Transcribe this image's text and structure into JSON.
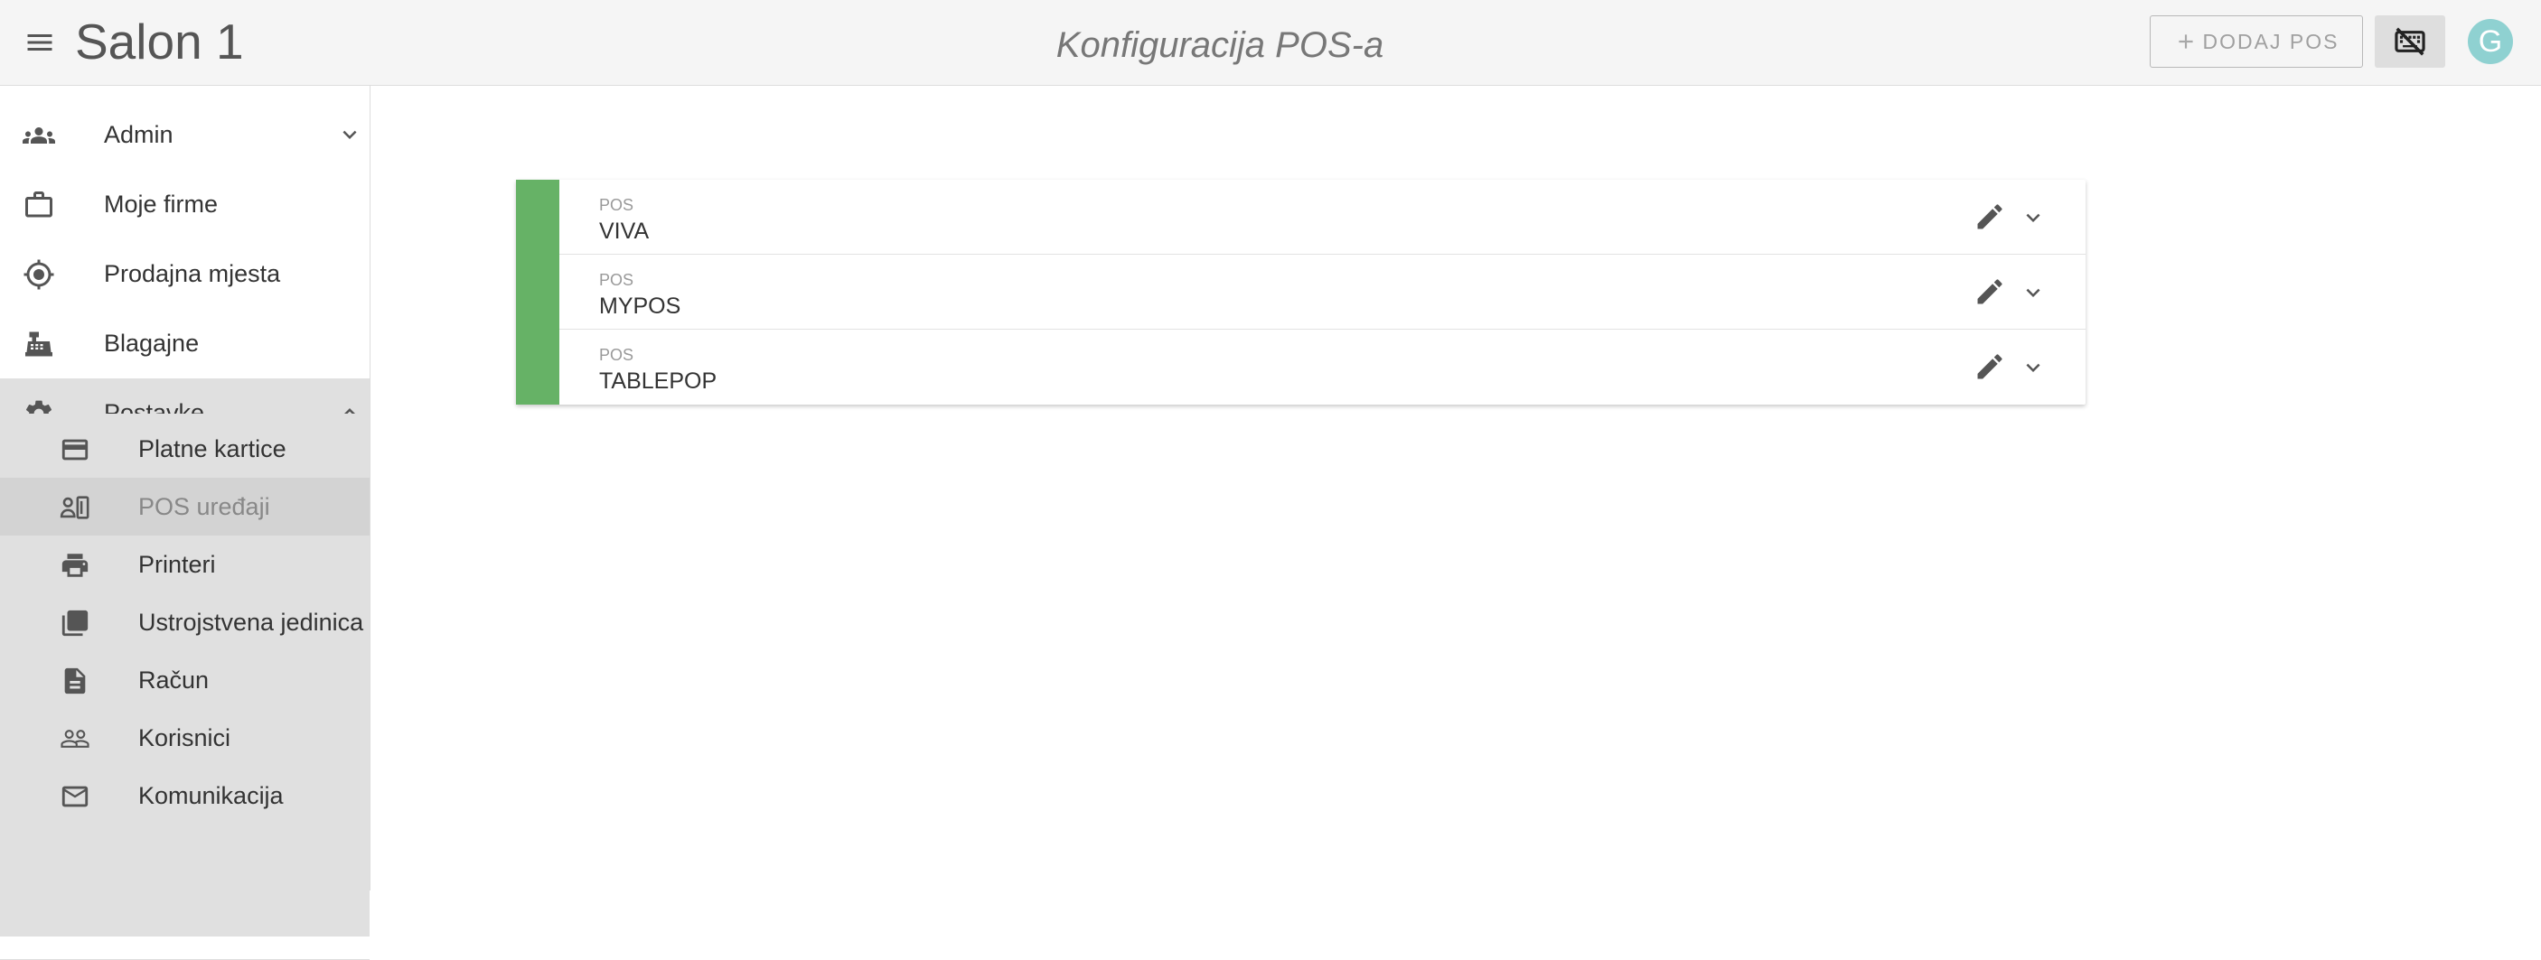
{
  "header": {
    "app_title": "Salon 1",
    "page_title": "Konfiguracija POS-a",
    "add_button_label": "DODAJ POS",
    "avatar_initial": "G"
  },
  "sidebar": {
    "items": [
      {
        "label": "Admin",
        "icon": "people-icon",
        "chevron": "down"
      },
      {
        "label": "Moje firme",
        "icon": "briefcase-icon"
      },
      {
        "label": "Prodajna mjesta",
        "icon": "location-icon"
      },
      {
        "label": "Blagajne",
        "icon": "cash-register-icon"
      },
      {
        "label": "Postavke",
        "icon": "gear-icon",
        "chevron": "up",
        "expanded": true
      }
    ],
    "subitems": [
      {
        "label": "Platne kartice",
        "icon": "credit-card-icon"
      },
      {
        "label": "POS uređaji",
        "icon": "pos-device-icon",
        "active": true
      },
      {
        "label": "Printeri",
        "icon": "printer-icon"
      },
      {
        "label": "Ustrojstvena jedinica",
        "icon": "library-icon"
      },
      {
        "label": "Račun",
        "icon": "receipt-icon"
      },
      {
        "label": "Korisnici",
        "icon": "users-icon"
      },
      {
        "label": "Komunikacija",
        "icon": "mail-icon"
      }
    ]
  },
  "pos_list": {
    "rows": [
      {
        "caption": "POS",
        "name": "VIVA"
      },
      {
        "caption": "POS",
        "name": "MYPOS"
      },
      {
        "caption": "POS",
        "name": "TABLEPOP"
      }
    ]
  },
  "colors": {
    "accent_green": "#66b266",
    "header_bg": "#f5f5f5",
    "submenu_bg": "#e0e0e0",
    "avatar_bg": "#8fd1d1"
  }
}
